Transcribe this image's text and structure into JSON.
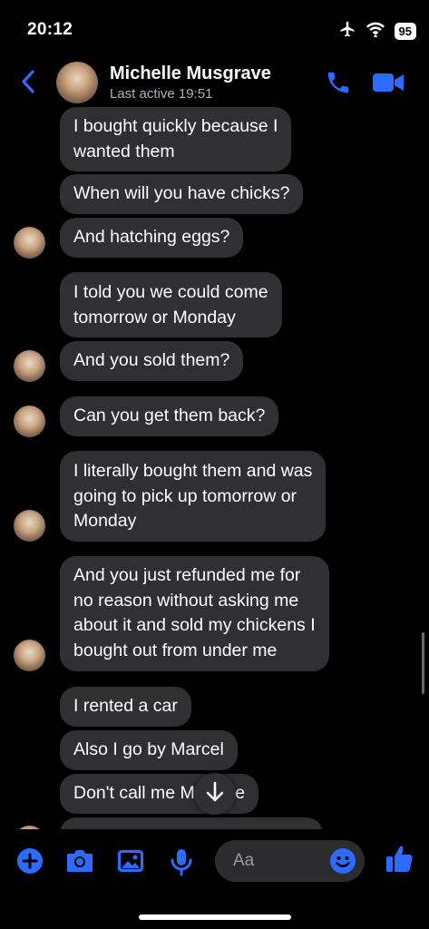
{
  "status_bar": {
    "time": "20:12",
    "battery": "95"
  },
  "header": {
    "contact_name": "Michelle Musgrave",
    "last_active": "Last active 19:51"
  },
  "messages": [
    {
      "lines": [
        "I bought quickly because I",
        "wanted them"
      ]
    },
    {
      "lines": [
        "When will you have chicks?"
      ]
    },
    {
      "lines": [
        "And hatching eggs?"
      ]
    },
    {
      "lines": [
        "I told you we could come",
        "tomorrow or Monday"
      ]
    },
    {
      "lines": [
        "And you sold them?"
      ]
    },
    {
      "lines": [
        "Can you get them back?"
      ]
    },
    {
      "lines": [
        "I literally bought them and was",
        "going to pick up tomorrow or",
        "Monday"
      ]
    },
    {
      "lines": [
        "And you just refunded me for",
        "no reason without asking me",
        "about it and sold my chickens I",
        "bought out from under me"
      ]
    },
    {
      "lines": [
        "I rented a car"
      ]
    },
    {
      "lines": [
        "Also I go by Marcel"
      ]
    },
    {
      "lines": [
        "Don't call me Michelle"
      ]
    }
  ],
  "composer": {
    "placeholder": "Aa"
  },
  "colors": {
    "accent": "#2d6bff",
    "bubble": "#303033",
    "background": "#000000"
  },
  "icons": {
    "header": [
      "back-chevron-icon",
      "phone-icon",
      "video-camera-icon"
    ],
    "composer": [
      "plus-icon",
      "camera-icon",
      "image-icon",
      "microphone-icon",
      "emoji-icon",
      "thumbs-up-icon"
    ],
    "status": [
      "airplane-icon",
      "wifi-icon",
      "battery-icon"
    ],
    "scroll": "arrow-down-icon"
  }
}
